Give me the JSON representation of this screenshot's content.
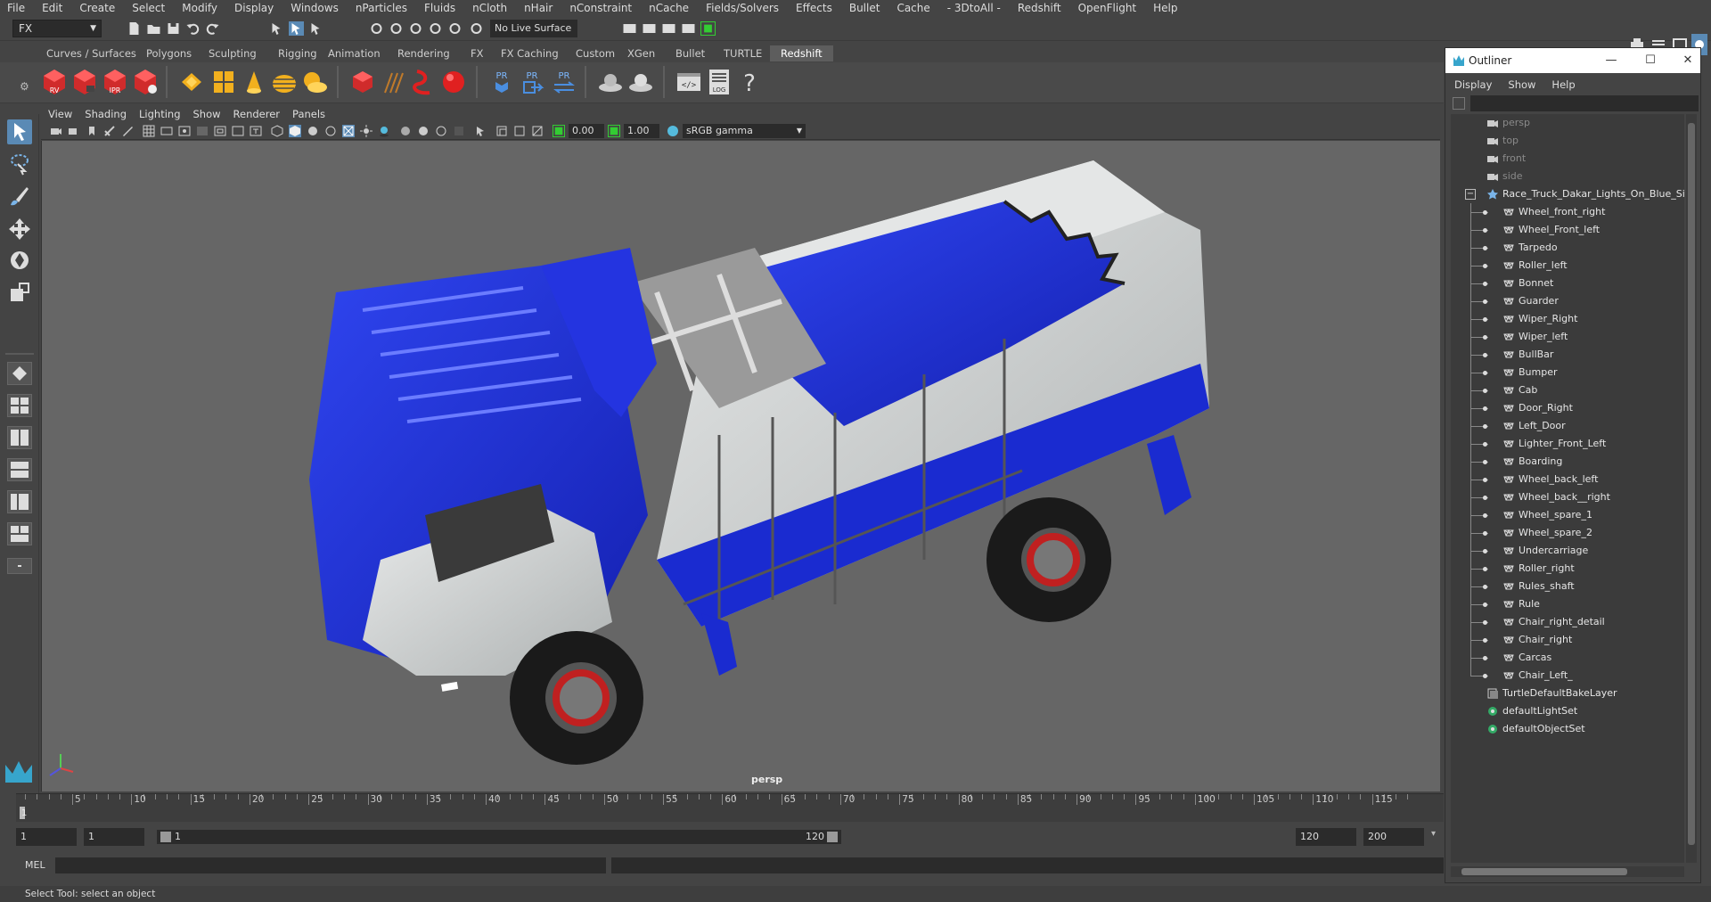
{
  "menubar": {
    "items": [
      "File",
      "Edit",
      "Create",
      "Select",
      "Modify",
      "Display",
      "Windows",
      "nParticles",
      "Fluids",
      "nCloth",
      "nHair",
      "nConstraint",
      "nCache",
      "Fields/Solvers",
      "Effects",
      "Bullet",
      "Cache",
      "- 3DtoAll -",
      "Redshift",
      "OpenFlight",
      "Help"
    ]
  },
  "statusline": {
    "mode": "FX",
    "live_surface": "No Live Surface"
  },
  "shelf": {
    "tabs": [
      "Curves / Surfaces",
      "Polygons",
      "Sculpting",
      "Rigging",
      "Animation",
      "Rendering",
      "FX",
      "FX Caching",
      "Custom",
      "XGen",
      "Bullet",
      "TURTLE",
      "Redshift"
    ],
    "active_tab": "Redshift",
    "icon_labels": {
      "rv": "RV",
      "ipr": "IPR",
      "pr1": "PR",
      "pr2": "PR",
      "pr3": "PR",
      "log": "LOG",
      "help": "?"
    }
  },
  "panel": {
    "menu": [
      "View",
      "Shading",
      "Lighting",
      "Show",
      "Renderer",
      "Panels"
    ],
    "exposure": "0.00",
    "gamma": "1.00",
    "color_space": "sRGB gamma",
    "camera": "persp"
  },
  "timeline": {
    "ticks": [
      5,
      10,
      15,
      20,
      25,
      30,
      35,
      40,
      45,
      50,
      55,
      60,
      65,
      70,
      75,
      80,
      85,
      90,
      95,
      100,
      105,
      110,
      115
    ],
    "current_frame": "1"
  },
  "range": {
    "start_anim": "1",
    "start_play": "1",
    "slider_start": "1",
    "slider_end": "120",
    "end_play": "120",
    "end_anim": "200"
  },
  "cmdline": {
    "language": "MEL"
  },
  "helpline": {
    "text": "Select Tool: select an object"
  },
  "outliner": {
    "title": "Outliner",
    "menu": [
      "Display",
      "Show",
      "Help"
    ],
    "cameras": [
      "persp",
      "top",
      "front",
      "side"
    ],
    "group": "Race_Truck_Dakar_Lights_On_Blue_Simple",
    "children": [
      "Wheel_front_right",
      "Wheel_Front_left",
      "Tarpedo",
      "Roller_left",
      "Bonnet",
      "Guarder",
      "Wiper_Right",
      "Wiper_left",
      "BullBar",
      "Bumper",
      "Cab",
      "Door_Right",
      "Left_Door",
      "Lighter_Front_Left",
      "Boarding",
      "Wheel_back_left",
      "Wheel_back__right",
      "Wheel_spare_1",
      "Wheel_spare_2",
      "Undercarriage",
      "Roller_right",
      "Rules_shaft",
      "Rule",
      "Chair_right_detail",
      "Chair_right",
      "Carcas",
      "Chair_Left_"
    ],
    "sets": [
      "TurtleDefaultBakeLayer",
      "defaultLightSet",
      "defaultObjectSet"
    ]
  },
  "colors": {
    "truck_blue": "#1a2bd0",
    "truck_white": "#d4d7d6",
    "viewport_bg": "#666666",
    "active_tab": "#5d5d5d",
    "accent": "#5a8ab5"
  }
}
